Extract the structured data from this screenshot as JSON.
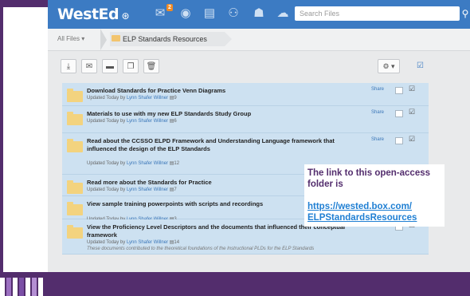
{
  "nav": {
    "logo": "WestEd",
    "notification_count": "2",
    "search_placeholder": "Search Files"
  },
  "breadcrumb": {
    "root": "All Files",
    "current": "ELP Standards Resources"
  },
  "toolbar": {
    "gear_label": "⚙ ▾"
  },
  "list": {
    "share_label": "Share",
    "items": [
      {
        "title": "Download Standards for Practice Venn Diagrams",
        "updated_prefix": "Updated Today by",
        "user": "Lynn Shafer Willner",
        "count": "9",
        "show_share": true
      },
      {
        "title": "Materials to use with my new ELP Standards Study Group",
        "updated_prefix": "Updated Today by",
        "user": "Lynn Shafer Willner",
        "count": "6",
        "show_share": true
      },
      {
        "title": "Read about the CCSSO ELPD Framework and Understanding Language framework that influenced the design of the ELP Standards",
        "updated_prefix": "Updated Today by",
        "user": "Lynn Shafer Willner",
        "count": "12",
        "show_share": true
      },
      {
        "title": "Read more about the Standards for Practice",
        "updated_prefix": "Updated Today by",
        "user": "Lynn Shafer Willner",
        "count": "7",
        "show_share": false
      },
      {
        "title": "View sample training powerpoints with scripts and recordings",
        "updated_prefix": "Updated Today by",
        "user": "Lynn Shafer Willner",
        "count": "3",
        "show_share": false
      },
      {
        "title": "View the Proficiency Level Descriptors and the documents that influenced their conceptual framework",
        "updated_prefix": "Updated Today by",
        "user": "Lynn Shafer Willner",
        "count": "14",
        "description": "These documents contributed to the theoretical foundations of the Instructional PLDs for the ELP Standards",
        "show_share": true
      }
    ]
  },
  "callout": {
    "text": "The link to this open-access folder is",
    "link": "https://wested.box.com/ELPStandardsResources",
    "link_line1": "https://wested.box.com/",
    "link_line2": "ELPStandardsResources"
  },
  "colors": {
    "frame": "#532d6d",
    "nav": "#3c7bc3",
    "row": "#cde1f1",
    "link": "#1f7fd3"
  },
  "decoration": {
    "stripe_colors": [
      "#ffffff",
      "#9b6fc0",
      "#ffffff",
      "#7b4fa6",
      "#ffffff",
      "#b48fd3",
      "#ffffff"
    ]
  }
}
